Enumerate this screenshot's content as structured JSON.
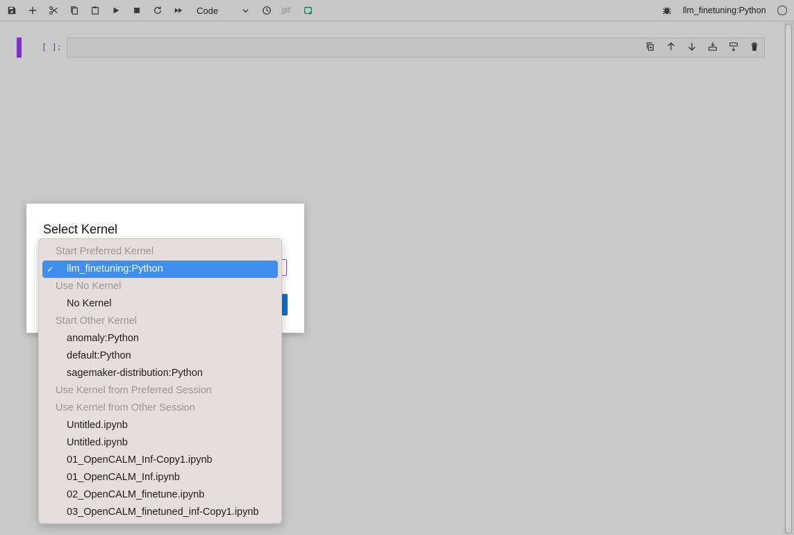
{
  "toolbar": {
    "cell_type": "Code",
    "git_label": "git",
    "kernel_name": "llm_finetuning:Python",
    "buttons": [
      "save-icon",
      "add-icon",
      "cut-icon",
      "copy-icon",
      "paste-icon",
      "run-icon",
      "stop-icon",
      "restart-icon",
      "fast-forward-icon",
      "clock-icon",
      "git-icon",
      "schedule-icon"
    ]
  },
  "cell": {
    "prompt": "[ ]:",
    "tools": [
      "duplicate-icon",
      "move-up-icon",
      "move-down-icon",
      "insert-below-icon",
      "insert-above-icon",
      "delete-icon"
    ]
  },
  "dialog": {
    "title": "Select Kernel"
  },
  "menu": {
    "rows": [
      {
        "kind": "header",
        "label": "Start Preferred Kernel"
      },
      {
        "kind": "selected",
        "label": "llm_finetuning:Python",
        "check": "✓"
      },
      {
        "kind": "header",
        "label": "Use No Kernel"
      },
      {
        "kind": "item",
        "label": "No Kernel"
      },
      {
        "kind": "header",
        "label": "Start Other Kernel"
      },
      {
        "kind": "item",
        "label": "anomaly:Python"
      },
      {
        "kind": "item",
        "label": "default:Python"
      },
      {
        "kind": "item",
        "label": "sagemaker-distribution:Python"
      },
      {
        "kind": "header",
        "label": "Use Kernel from Preferred Session"
      },
      {
        "kind": "header",
        "label": "Use Kernel from Other Session"
      },
      {
        "kind": "item",
        "label": "Untitled.ipynb"
      },
      {
        "kind": "item",
        "label": "Untitled.ipynb"
      },
      {
        "kind": "item",
        "label": "01_OpenCALM_Inf-Copy1.ipynb"
      },
      {
        "kind": "item",
        "label": "01_OpenCALM_Inf.ipynb"
      },
      {
        "kind": "item",
        "label": "02_OpenCALM_finetune.ipynb"
      },
      {
        "kind": "item",
        "label": "03_OpenCALM_finetuned_inf-Copy1.ipynb"
      }
    ]
  },
  "colors": {
    "accent": "#7a2fc6",
    "selection": "#3e8ef0",
    "primary_button": "#1270c4",
    "prompt": "#2f5b93"
  }
}
